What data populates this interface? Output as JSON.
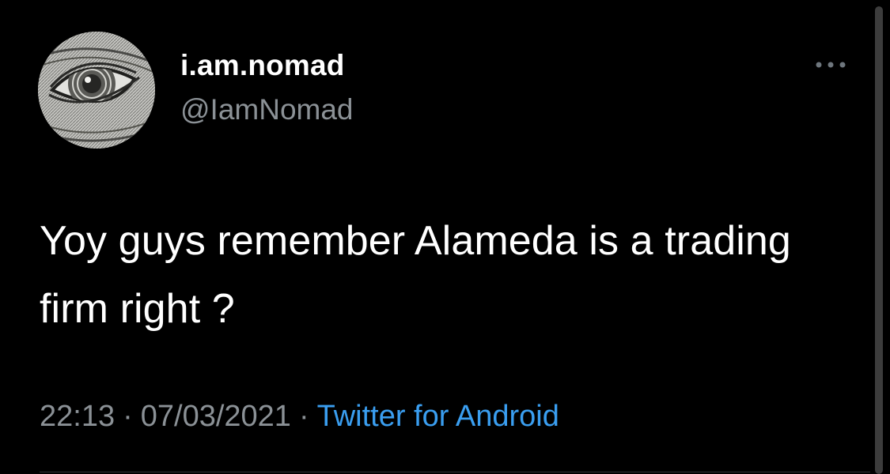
{
  "tweet": {
    "author": {
      "display_name": "i.am.nomad",
      "handle": "@IamNomad",
      "avatar_icon": "eye-engraving-avatar"
    },
    "more_icon": "ellipsis-icon",
    "text": "Yoy guys remember Alameda is a trading firm right ?",
    "time": "22:13",
    "date": "07/03/2021",
    "separator": "·",
    "source": "Twitter for Android"
  },
  "colors": {
    "background": "#000000",
    "text_primary": "#ffffff",
    "text_secondary": "#8b9196",
    "link": "#3a9ef0"
  }
}
